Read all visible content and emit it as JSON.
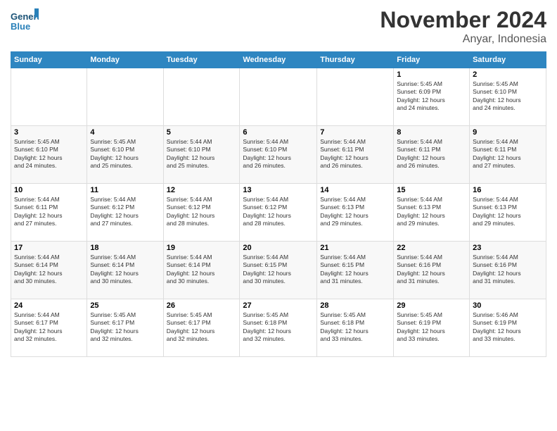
{
  "header": {
    "logo_line1": "General",
    "logo_line2": "Blue",
    "title": "November 2024",
    "subtitle": "Anyar, Indonesia"
  },
  "weekdays": [
    "Sunday",
    "Monday",
    "Tuesday",
    "Wednesday",
    "Thursday",
    "Friday",
    "Saturday"
  ],
  "weeks": [
    [
      {
        "day": "",
        "info": ""
      },
      {
        "day": "",
        "info": ""
      },
      {
        "day": "",
        "info": ""
      },
      {
        "day": "",
        "info": ""
      },
      {
        "day": "",
        "info": ""
      },
      {
        "day": "1",
        "info": "Sunrise: 5:45 AM\nSunset: 6:09 PM\nDaylight: 12 hours\nand 24 minutes."
      },
      {
        "day": "2",
        "info": "Sunrise: 5:45 AM\nSunset: 6:10 PM\nDaylight: 12 hours\nand 24 minutes."
      }
    ],
    [
      {
        "day": "3",
        "info": "Sunrise: 5:45 AM\nSunset: 6:10 PM\nDaylight: 12 hours\nand 24 minutes."
      },
      {
        "day": "4",
        "info": "Sunrise: 5:45 AM\nSunset: 6:10 PM\nDaylight: 12 hours\nand 25 minutes."
      },
      {
        "day": "5",
        "info": "Sunrise: 5:44 AM\nSunset: 6:10 PM\nDaylight: 12 hours\nand 25 minutes."
      },
      {
        "day": "6",
        "info": "Sunrise: 5:44 AM\nSunset: 6:10 PM\nDaylight: 12 hours\nand 26 minutes."
      },
      {
        "day": "7",
        "info": "Sunrise: 5:44 AM\nSunset: 6:11 PM\nDaylight: 12 hours\nand 26 minutes."
      },
      {
        "day": "8",
        "info": "Sunrise: 5:44 AM\nSunset: 6:11 PM\nDaylight: 12 hours\nand 26 minutes."
      },
      {
        "day": "9",
        "info": "Sunrise: 5:44 AM\nSunset: 6:11 PM\nDaylight: 12 hours\nand 27 minutes."
      }
    ],
    [
      {
        "day": "10",
        "info": "Sunrise: 5:44 AM\nSunset: 6:11 PM\nDaylight: 12 hours\nand 27 minutes."
      },
      {
        "day": "11",
        "info": "Sunrise: 5:44 AM\nSunset: 6:12 PM\nDaylight: 12 hours\nand 27 minutes."
      },
      {
        "day": "12",
        "info": "Sunrise: 5:44 AM\nSunset: 6:12 PM\nDaylight: 12 hours\nand 28 minutes."
      },
      {
        "day": "13",
        "info": "Sunrise: 5:44 AM\nSunset: 6:12 PM\nDaylight: 12 hours\nand 28 minutes."
      },
      {
        "day": "14",
        "info": "Sunrise: 5:44 AM\nSunset: 6:13 PM\nDaylight: 12 hours\nand 29 minutes."
      },
      {
        "day": "15",
        "info": "Sunrise: 5:44 AM\nSunset: 6:13 PM\nDaylight: 12 hours\nand 29 minutes."
      },
      {
        "day": "16",
        "info": "Sunrise: 5:44 AM\nSunset: 6:13 PM\nDaylight: 12 hours\nand 29 minutes."
      }
    ],
    [
      {
        "day": "17",
        "info": "Sunrise: 5:44 AM\nSunset: 6:14 PM\nDaylight: 12 hours\nand 30 minutes."
      },
      {
        "day": "18",
        "info": "Sunrise: 5:44 AM\nSunset: 6:14 PM\nDaylight: 12 hours\nand 30 minutes."
      },
      {
        "day": "19",
        "info": "Sunrise: 5:44 AM\nSunset: 6:14 PM\nDaylight: 12 hours\nand 30 minutes."
      },
      {
        "day": "20",
        "info": "Sunrise: 5:44 AM\nSunset: 6:15 PM\nDaylight: 12 hours\nand 30 minutes."
      },
      {
        "day": "21",
        "info": "Sunrise: 5:44 AM\nSunset: 6:15 PM\nDaylight: 12 hours\nand 31 minutes."
      },
      {
        "day": "22",
        "info": "Sunrise: 5:44 AM\nSunset: 6:16 PM\nDaylight: 12 hours\nand 31 minutes."
      },
      {
        "day": "23",
        "info": "Sunrise: 5:44 AM\nSunset: 6:16 PM\nDaylight: 12 hours\nand 31 minutes."
      }
    ],
    [
      {
        "day": "24",
        "info": "Sunrise: 5:44 AM\nSunset: 6:17 PM\nDaylight: 12 hours\nand 32 minutes."
      },
      {
        "day": "25",
        "info": "Sunrise: 5:45 AM\nSunset: 6:17 PM\nDaylight: 12 hours\nand 32 minutes."
      },
      {
        "day": "26",
        "info": "Sunrise: 5:45 AM\nSunset: 6:17 PM\nDaylight: 12 hours\nand 32 minutes."
      },
      {
        "day": "27",
        "info": "Sunrise: 5:45 AM\nSunset: 6:18 PM\nDaylight: 12 hours\nand 32 minutes."
      },
      {
        "day": "28",
        "info": "Sunrise: 5:45 AM\nSunset: 6:18 PM\nDaylight: 12 hours\nand 33 minutes."
      },
      {
        "day": "29",
        "info": "Sunrise: 5:45 AM\nSunset: 6:19 PM\nDaylight: 12 hours\nand 33 minutes."
      },
      {
        "day": "30",
        "info": "Sunrise: 5:46 AM\nSunset: 6:19 PM\nDaylight: 12 hours\nand 33 minutes."
      }
    ]
  ]
}
